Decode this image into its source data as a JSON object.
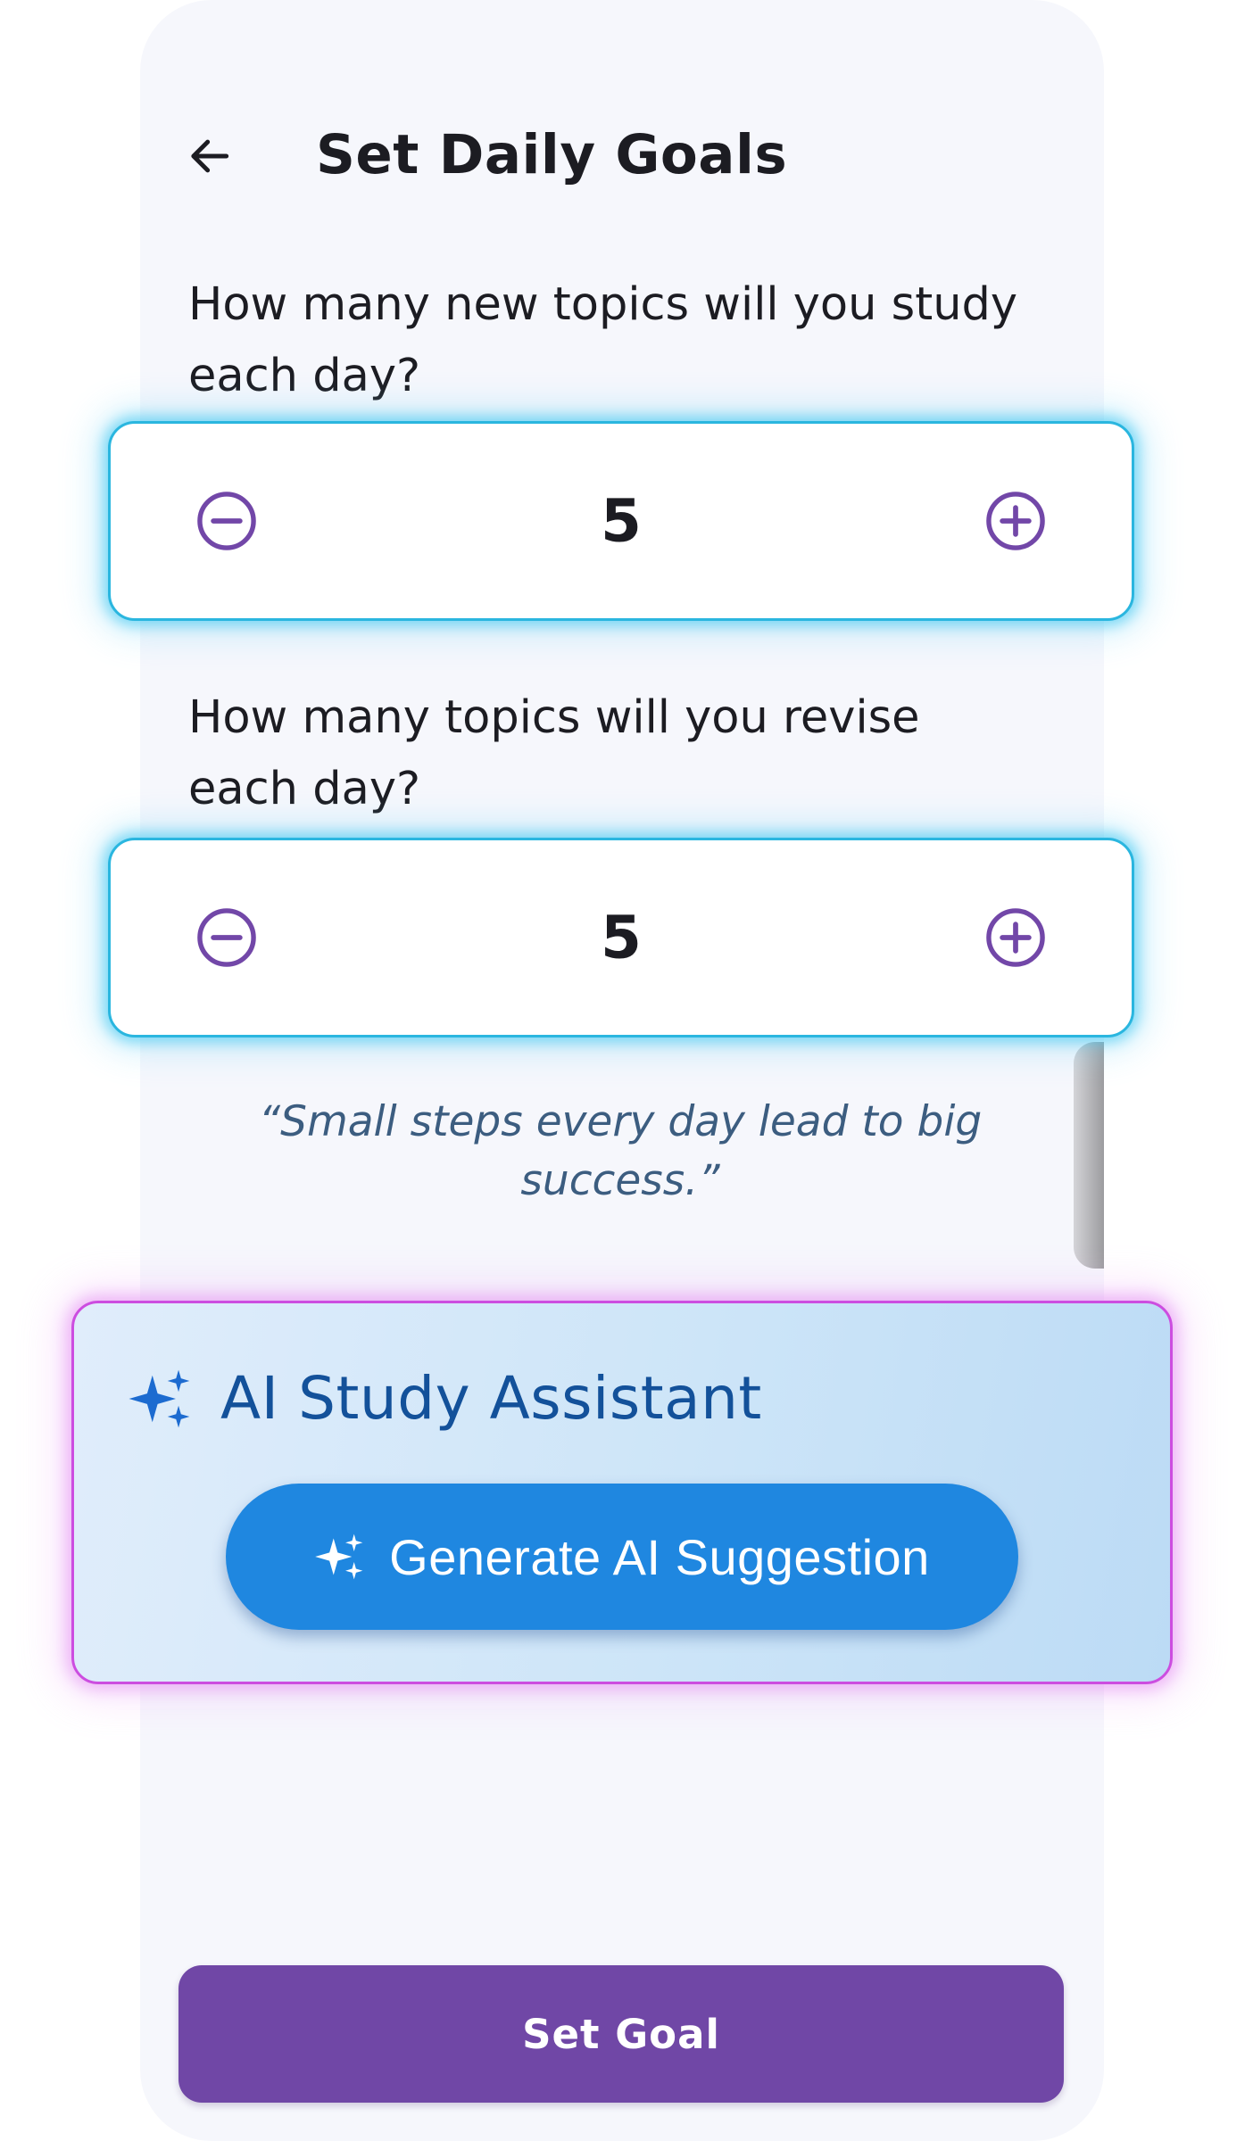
{
  "header": {
    "back_icon": "arrow-left-icon",
    "title": "Set Daily Goals"
  },
  "new_topics": {
    "question": "How many new topics will you study each day?",
    "value": "5",
    "decrement_icon": "minus-circle-icon",
    "increment_icon": "plus-circle-icon"
  },
  "revise_topics": {
    "question": "How many topics will you revise each day?",
    "value": "5",
    "decrement_icon": "minus-circle-icon",
    "increment_icon": "plus-circle-icon"
  },
  "quote": "“Small steps every day lead to big success.”",
  "ai_assistant": {
    "icon": "sparkle-icon",
    "title": "AI Study Assistant",
    "button_label": "Generate AI Suggestion",
    "button_icon": "sparkle-icon"
  },
  "footer": {
    "set_goal_label": "Set Goal"
  },
  "colors": {
    "primary_purple": "#7047a6",
    "stepper_icon": "#7247a8",
    "ai_blue": "#1f87e0",
    "ai_title": "#13519a",
    "stepper_glow": "#2ab6df",
    "ai_card_glow": "#cc4de0",
    "quote_text": "#3c5d80"
  }
}
